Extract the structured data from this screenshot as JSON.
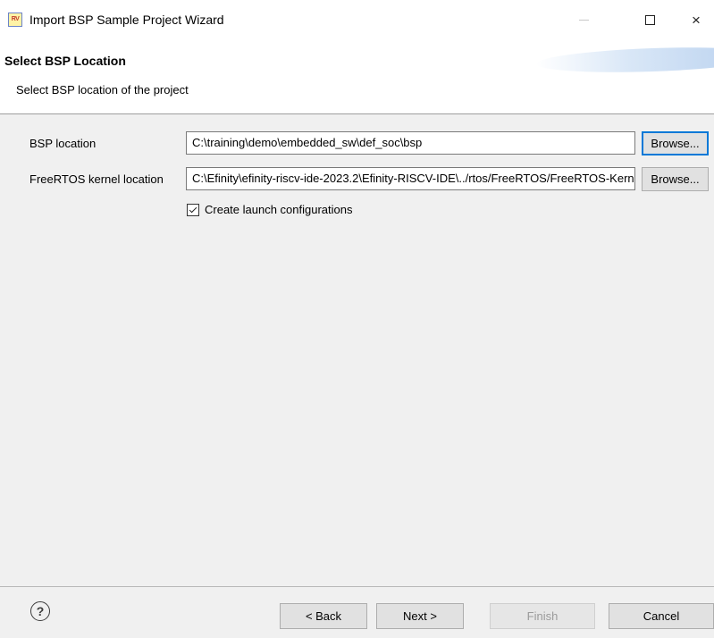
{
  "window": {
    "title": "Import BSP Sample Project Wizard",
    "app_icon_text": "RV",
    "controls": {
      "minimize": "minimize-icon",
      "maximize": "maximize-icon",
      "close": "×"
    }
  },
  "banner": {
    "title": "Select BSP Location",
    "description": "Select BSP location of the project"
  },
  "form": {
    "bsp_location": {
      "label": "BSP location",
      "value": "C:\\training\\demo\\embedded_sw\\def_soc\\bsp",
      "button": "Browse..."
    },
    "freertos_location": {
      "label": "FreeRTOS kernel location",
      "value": "C:\\Efinity\\efinity-riscv-ide-2023.2\\Efinity-RISCV-IDE\\../rtos/FreeRTOS/FreeRTOS-Kernel",
      "button": "Browse..."
    },
    "create_launch": {
      "label": "Create launch configurations",
      "checked": true
    }
  },
  "footer": {
    "help": "?",
    "back": "< Back",
    "next": "Next >",
    "finish": "Finish",
    "cancel": "Cancel"
  },
  "colors": {
    "focus_border": "#0078d7",
    "dialog_bg": "#f0f0f0",
    "disabled_text": "#9b9b9b"
  }
}
